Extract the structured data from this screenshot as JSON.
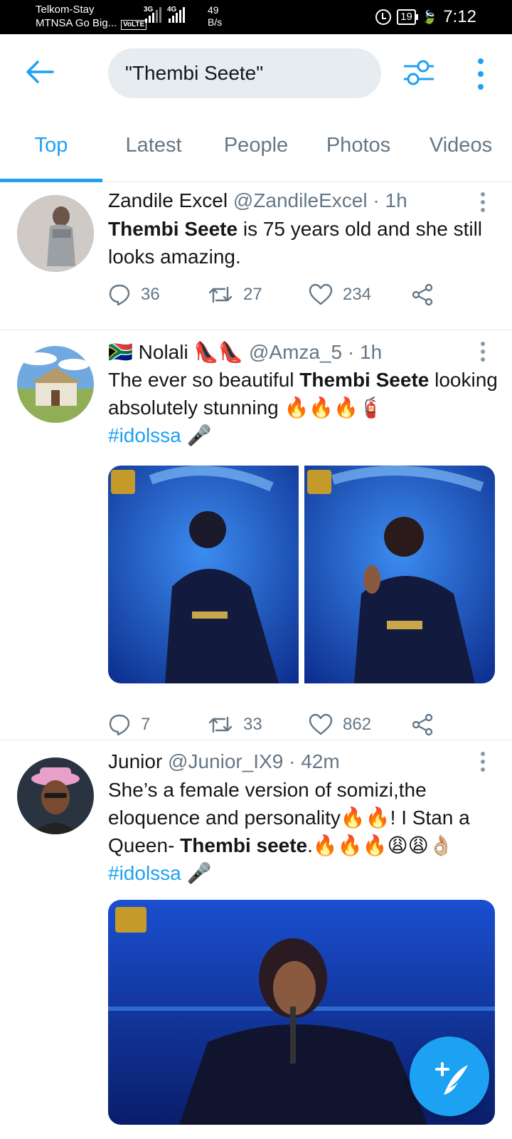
{
  "status_bar": {
    "carrier1": "Telkom-Stay",
    "carrier2": "MTNSA Go Big...",
    "net1": "3G",
    "net2": "4G",
    "volte": "VoLTE",
    "speed_value": "49",
    "speed_unit": "B/s",
    "battery": "19",
    "time": "7:12"
  },
  "header": {
    "search_value": "\"Thembi Seete\""
  },
  "tabs": [
    {
      "label": "Top",
      "active": true
    },
    {
      "label": "Latest",
      "active": false
    },
    {
      "label": "People",
      "active": false
    },
    {
      "label": "Photos",
      "active": false
    },
    {
      "label": "Videos",
      "active": false
    }
  ],
  "tweets": [
    {
      "name": "Zandile Excel",
      "handle": "@ZandileExcel",
      "time": "1h",
      "text_bold": "Thembi Seete",
      "text_rest": " is 75 years old and she still looks amazing.",
      "replies": "36",
      "retweets": "27",
      "likes": "234"
    },
    {
      "name_flag": "🇿🇦",
      "name": "Nolali",
      "name_emoji": "👠👠",
      "handle": "@Amza_5",
      "time": "1h",
      "text_pre": "The ever so beautiful ",
      "text_bold": "Thembi Seete",
      "text_post": " looking absolutely stunning 🔥🔥🔥🧯",
      "hashtag": "#idolssa",
      "hashtag_emoji": "🎤",
      "replies": "7",
      "retweets": "33",
      "likes": "862"
    },
    {
      "name": "Junior",
      "handle": "@Junior_IX9",
      "time": "42m",
      "text_pre": "She’s a female version of somizi,the eloquence and personality🔥🔥! I Stan a Queen- ",
      "text_bold": "Thembi seete",
      "text_post": ".🔥🔥🔥😩😩👌🏼",
      "hashtag": "#idolssa",
      "hashtag_emoji": "🎤"
    }
  ],
  "colors": {
    "accent": "#1da1f2",
    "secondary_text": "#657786",
    "divider": "#e1e8ed"
  }
}
